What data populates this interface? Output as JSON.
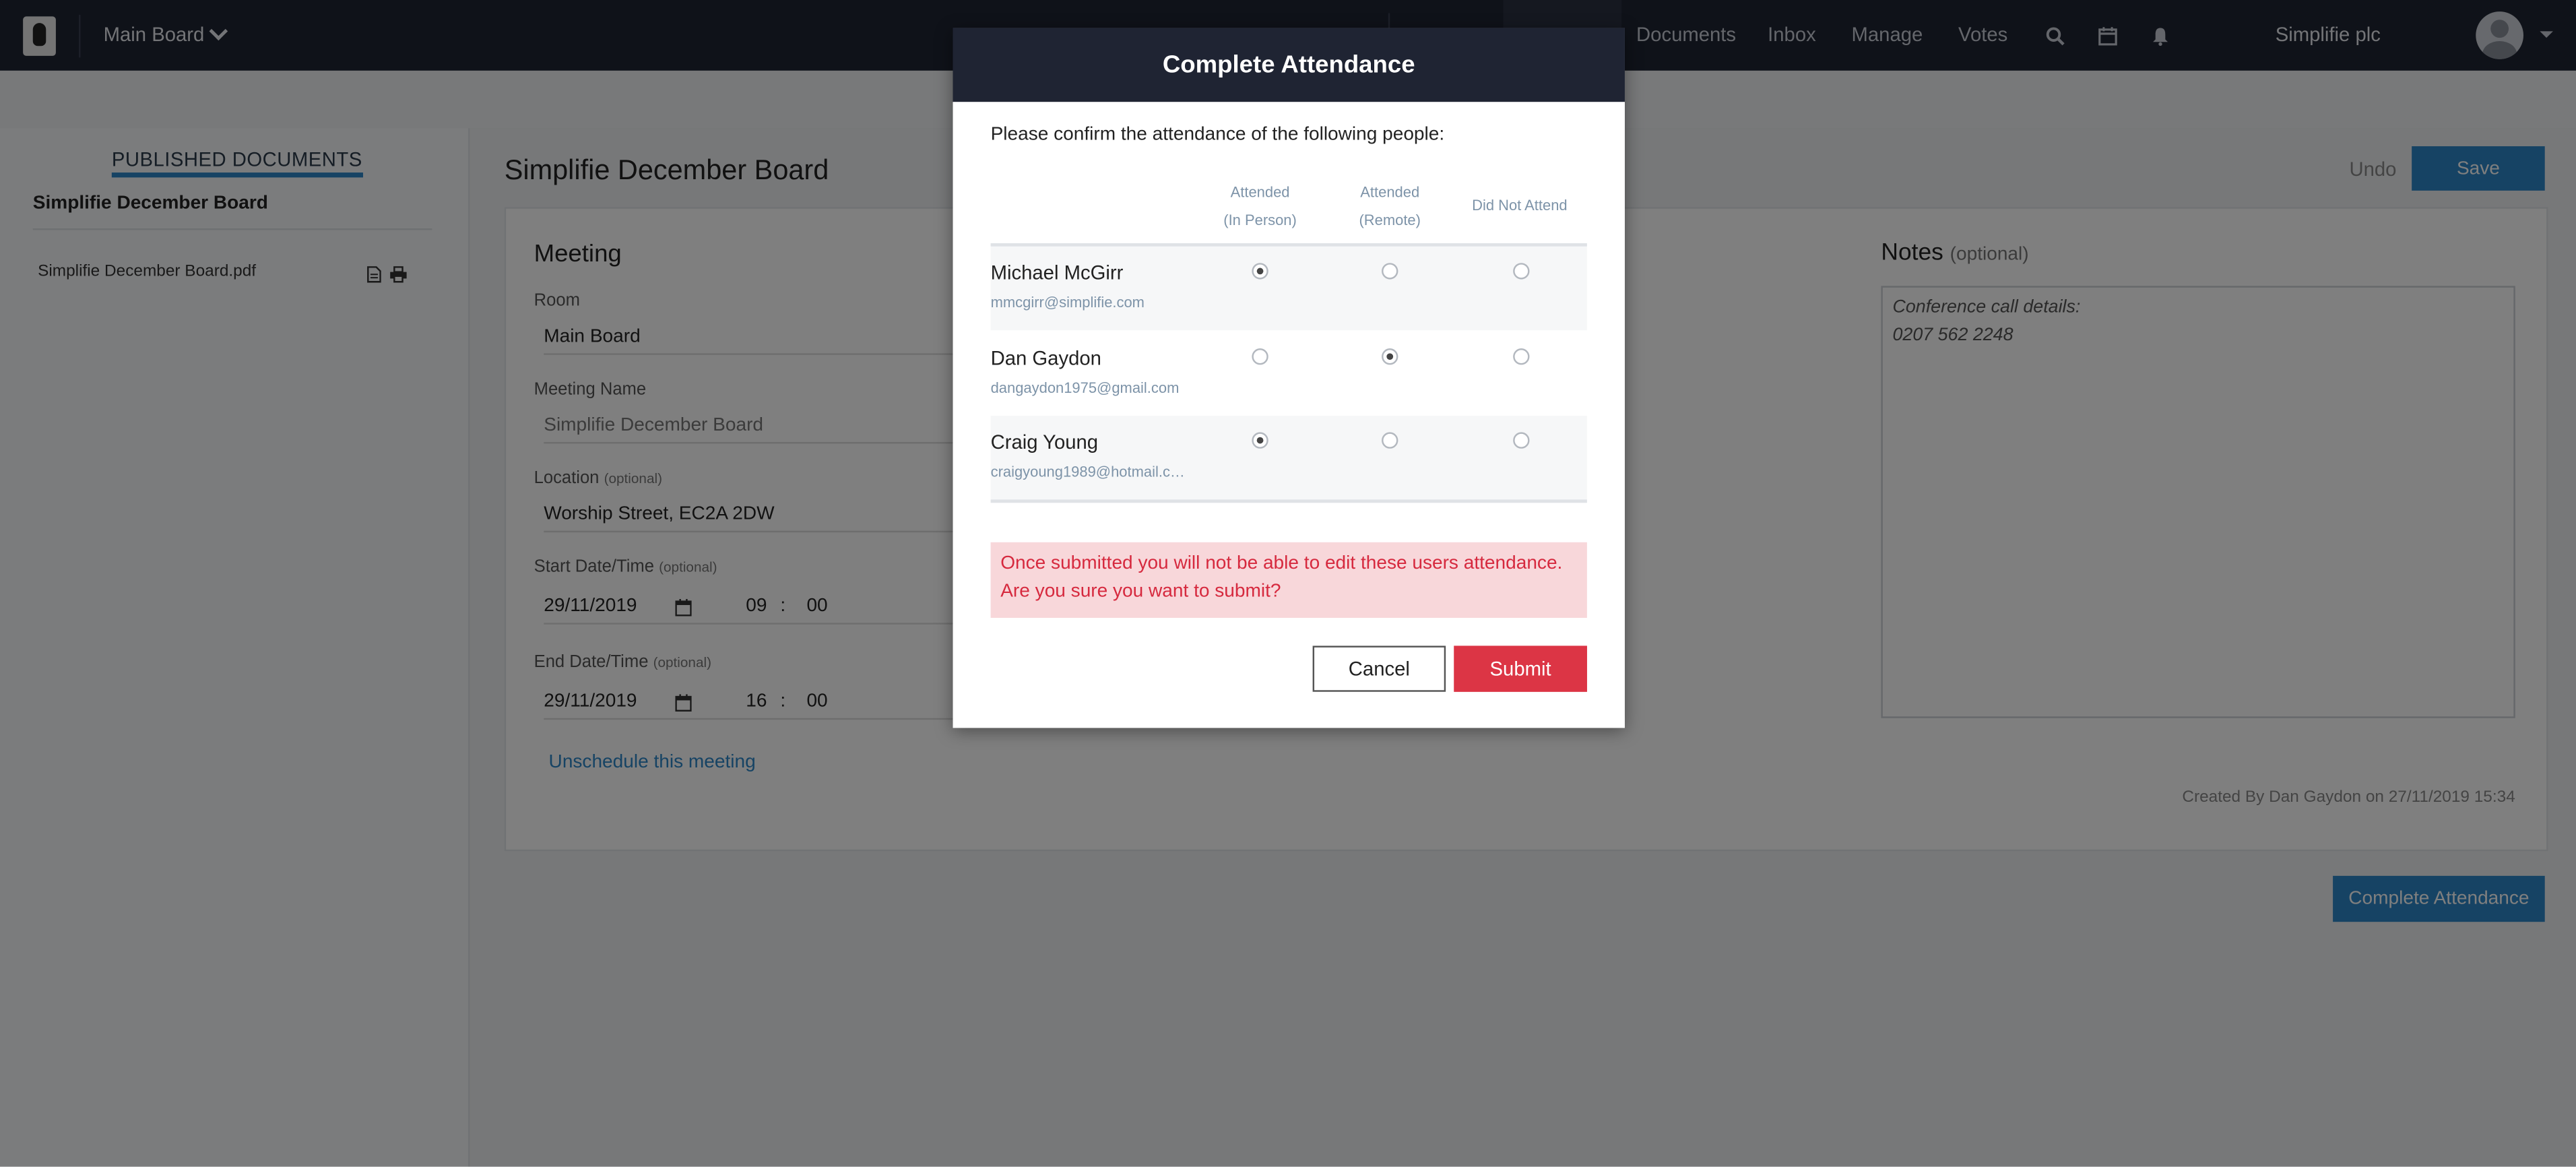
{
  "topbar": {
    "board_name": "Main Board",
    "nav": [
      "Documents",
      "Inbox",
      "Manage",
      "Votes"
    ],
    "company": "Simplifie plc"
  },
  "sidebar": {
    "heading": "PUBLISHED DOCUMENTS",
    "title": "Simplifie December Board",
    "file": "Simplifie December Board.pdf"
  },
  "main": {
    "page_title": "Simplifie December Board",
    "undo_label": "Undo",
    "save_label": "Save",
    "meeting": {
      "section_title": "Meeting",
      "room_label": "Room",
      "room_value": "Main Board",
      "name_label": "Meeting Name",
      "name_value": "Simplifie December Board",
      "location_label": "Location",
      "location_optional": "(optional)",
      "location_value": "Worship Street, EC2A 2DW",
      "start_label": "Start Date/Time",
      "start_optional": "(optional)",
      "start_date": "29/11/2019",
      "start_hour": "09",
      "start_min": "00",
      "end_label": "End Date/Time",
      "end_optional": "(optional)",
      "end_date": "29/11/2019",
      "end_hour": "16",
      "end_min": "00",
      "time_sep": ":",
      "unschedule_link": "Unschedule this meeting"
    },
    "notes": {
      "title": "Notes",
      "optional": "(optional)",
      "line1": "Conference call details:",
      "line2": "0207 562 2248"
    },
    "created_by": "Created By Dan Gaydon on 27/11/2019 15:34",
    "complete_label": "Complete Attendance"
  },
  "modal": {
    "title": "Complete Attendance",
    "intro": "Please confirm the attendance of the following people:",
    "columns": [
      {
        "line1": "Attended",
        "line2": "(In Person)"
      },
      {
        "line1": "Attended",
        "line2": "(Remote)"
      },
      {
        "line1": "Did Not Attend",
        "line2": ""
      }
    ],
    "people": [
      {
        "name": "Michael McGirr",
        "email": "mmcgirr@simplifie.com",
        "selected": "in_person"
      },
      {
        "name": "Dan Gaydon",
        "email": "dangaydon1975@gmail.com",
        "selected": "remote"
      },
      {
        "name": "Craig Young",
        "email": "craigyoung1989@hotmail.c…",
        "selected": "in_person"
      }
    ],
    "warning_line1": "Once submitted you will not be able to edit these users attendance.",
    "warning_line2": "Are you sure you want to submit?",
    "cancel_label": "Cancel",
    "submit_label": "Submit"
  }
}
